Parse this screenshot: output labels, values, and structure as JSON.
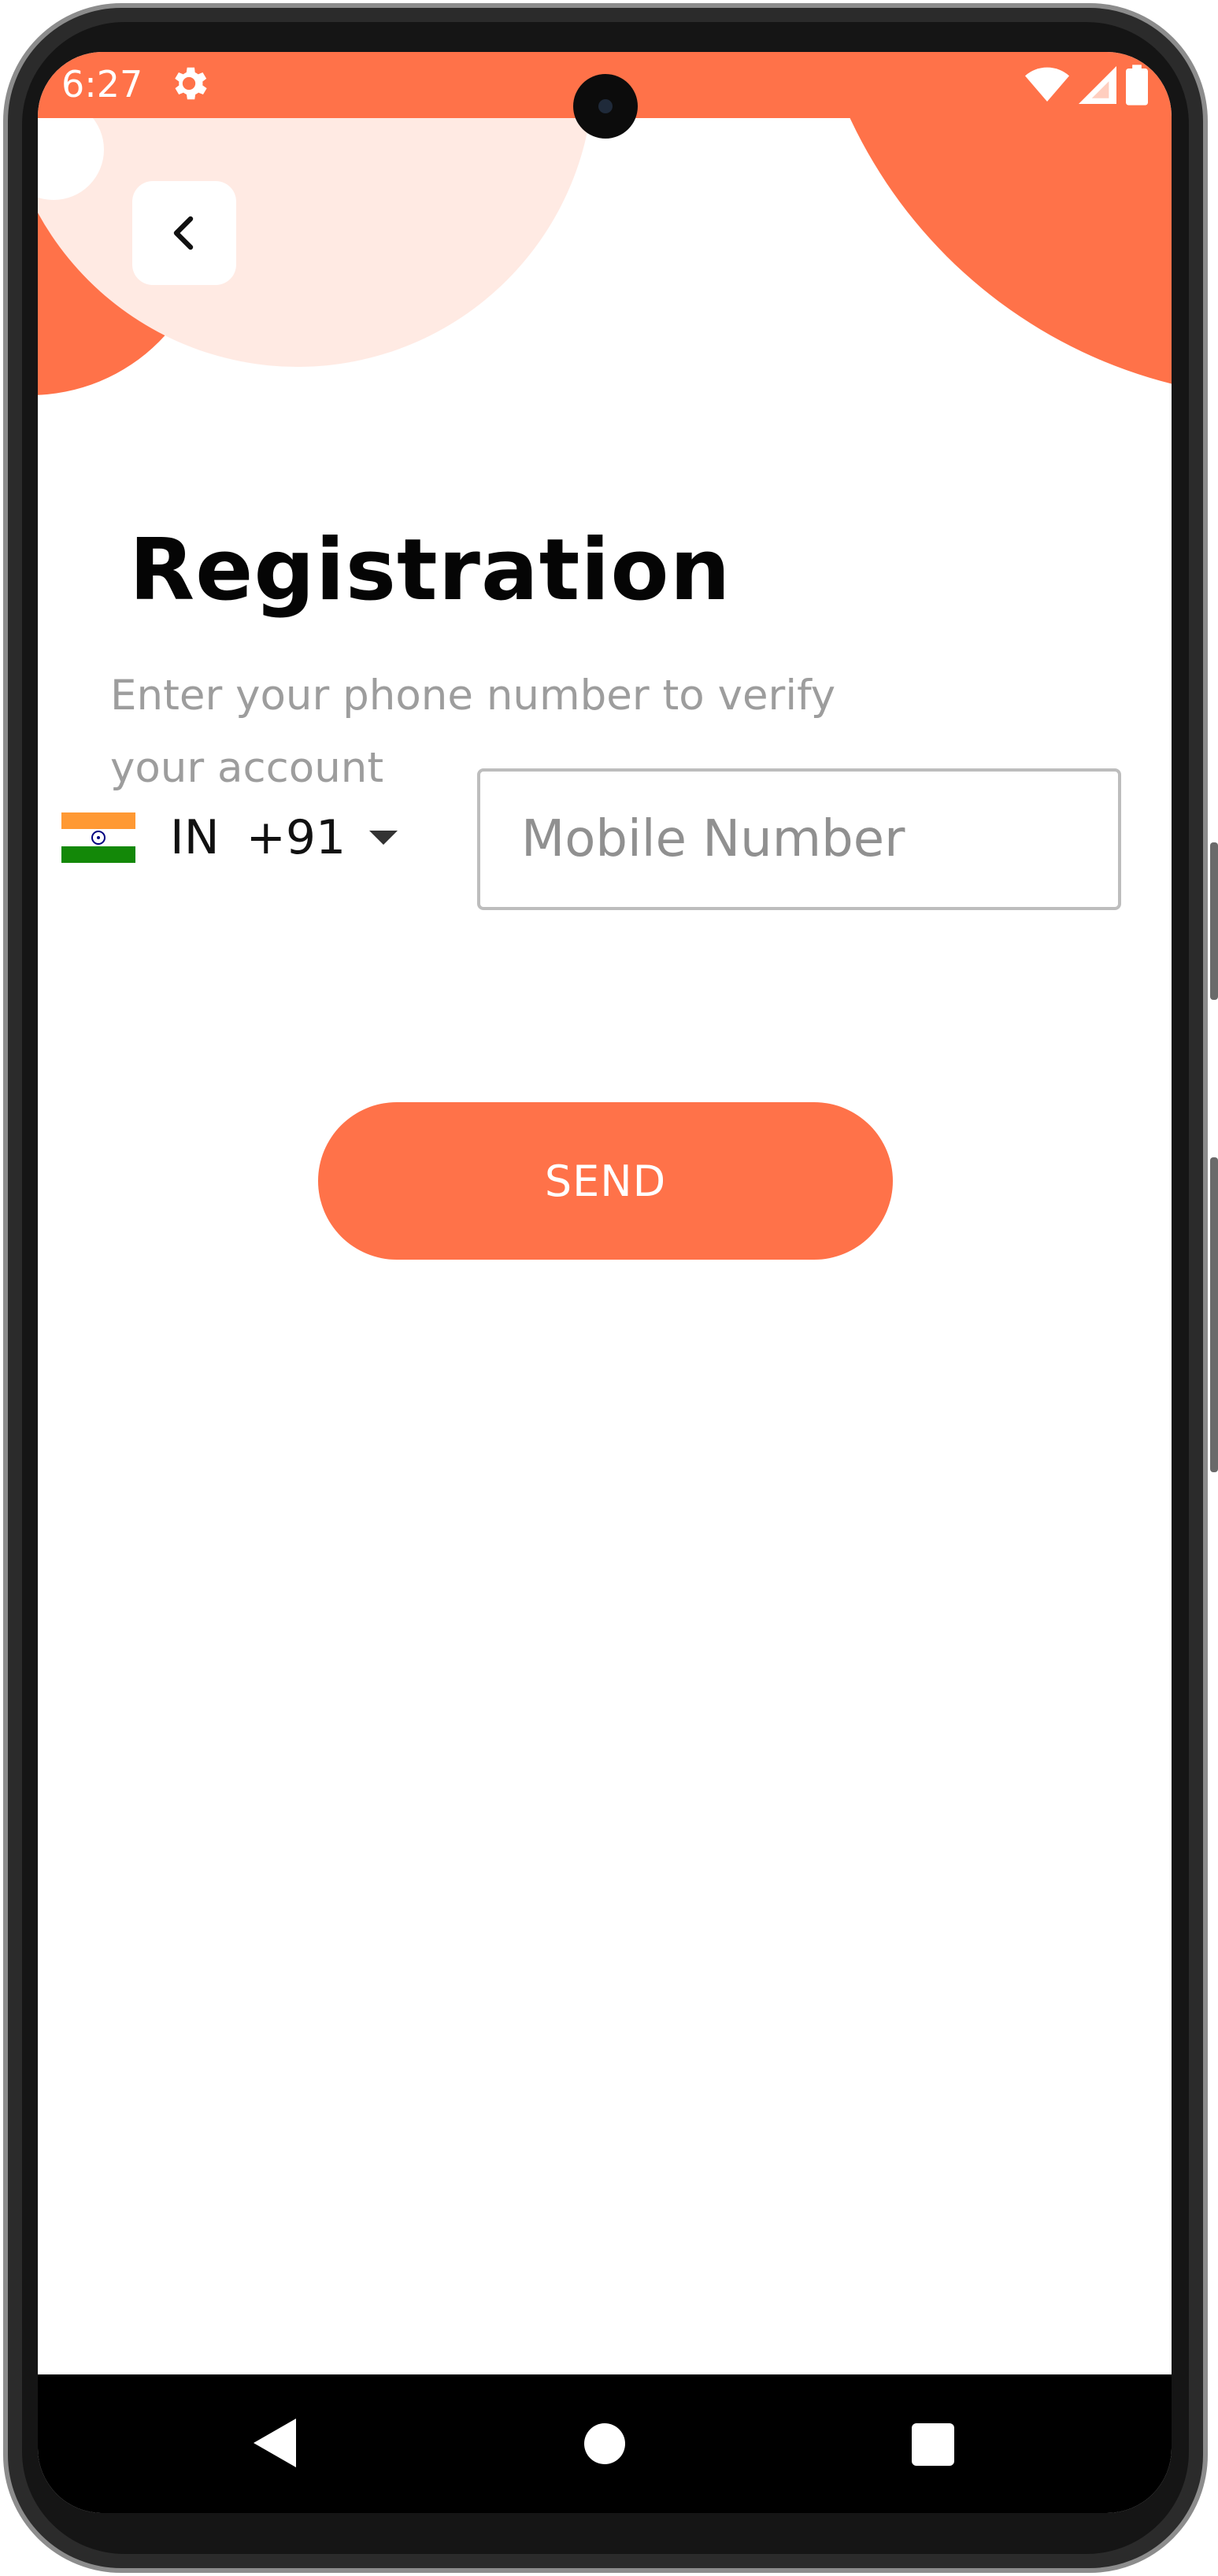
{
  "status_bar": {
    "time": "6:27",
    "icons": [
      "gear-icon",
      "wifi-icon",
      "signal-icon",
      "battery-icon"
    ]
  },
  "header": {
    "back_icon": "chevron-left-icon"
  },
  "registration": {
    "title": "Registration",
    "subtitle": "Enter your phone number to verify your account"
  },
  "phone": {
    "country_code": "IN",
    "dial_code": "+91",
    "flag": "india-flag-icon",
    "placeholder": "Mobile Number",
    "value": ""
  },
  "actions": {
    "send_label": "SEND"
  },
  "nav_bar": {
    "icons": [
      "nav-back-icon",
      "nav-home-icon",
      "nav-recents-icon"
    ]
  },
  "colors": {
    "accent": "#ff7249",
    "accent_light": "#ffeae3",
    "text_primary": "#050505",
    "text_secondary": "#9d9d9d"
  }
}
